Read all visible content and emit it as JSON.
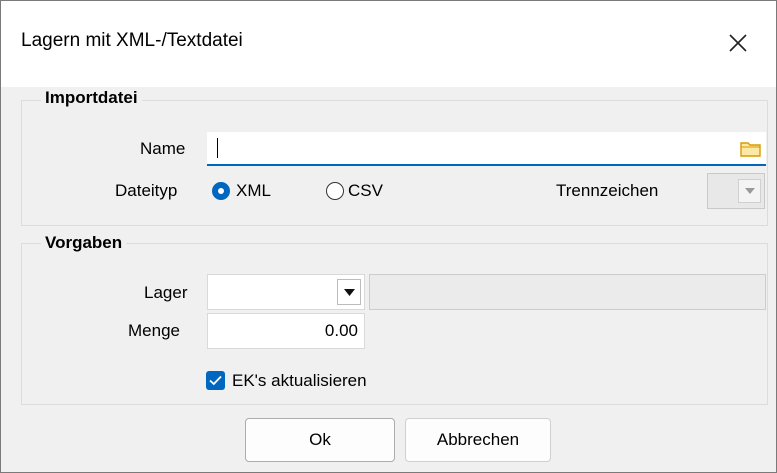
{
  "dialog": {
    "title": "Lagern mit XML-/Textdatei"
  },
  "importdatei": {
    "group_title": "Importdatei",
    "name_label": "Name",
    "name_value": "",
    "dateityp_label": "Dateityp",
    "dateityp_options": [
      {
        "label": "XML",
        "selected": true
      },
      {
        "label": "CSV",
        "selected": false
      }
    ],
    "trennzeichen_label": "Trennzeichen",
    "trennzeichen_value": ""
  },
  "vorgaben": {
    "group_title": "Vorgaben",
    "lager_label": "Lager",
    "lager_value": "",
    "lager_name_value": "",
    "menge_label": "Menge",
    "menge_value": "0.00",
    "ek_checkbox_label": "EK's aktualisieren",
    "ek_checkbox_checked": true
  },
  "buttons": {
    "ok_label": "Ok",
    "cancel_label": "Abbrechen"
  },
  "colors": {
    "accent": "#0067c0",
    "folder": "#e8b400"
  },
  "icons": {
    "close": "close-icon",
    "folder": "folder-icon",
    "dropdown": "chevron-down-icon"
  }
}
